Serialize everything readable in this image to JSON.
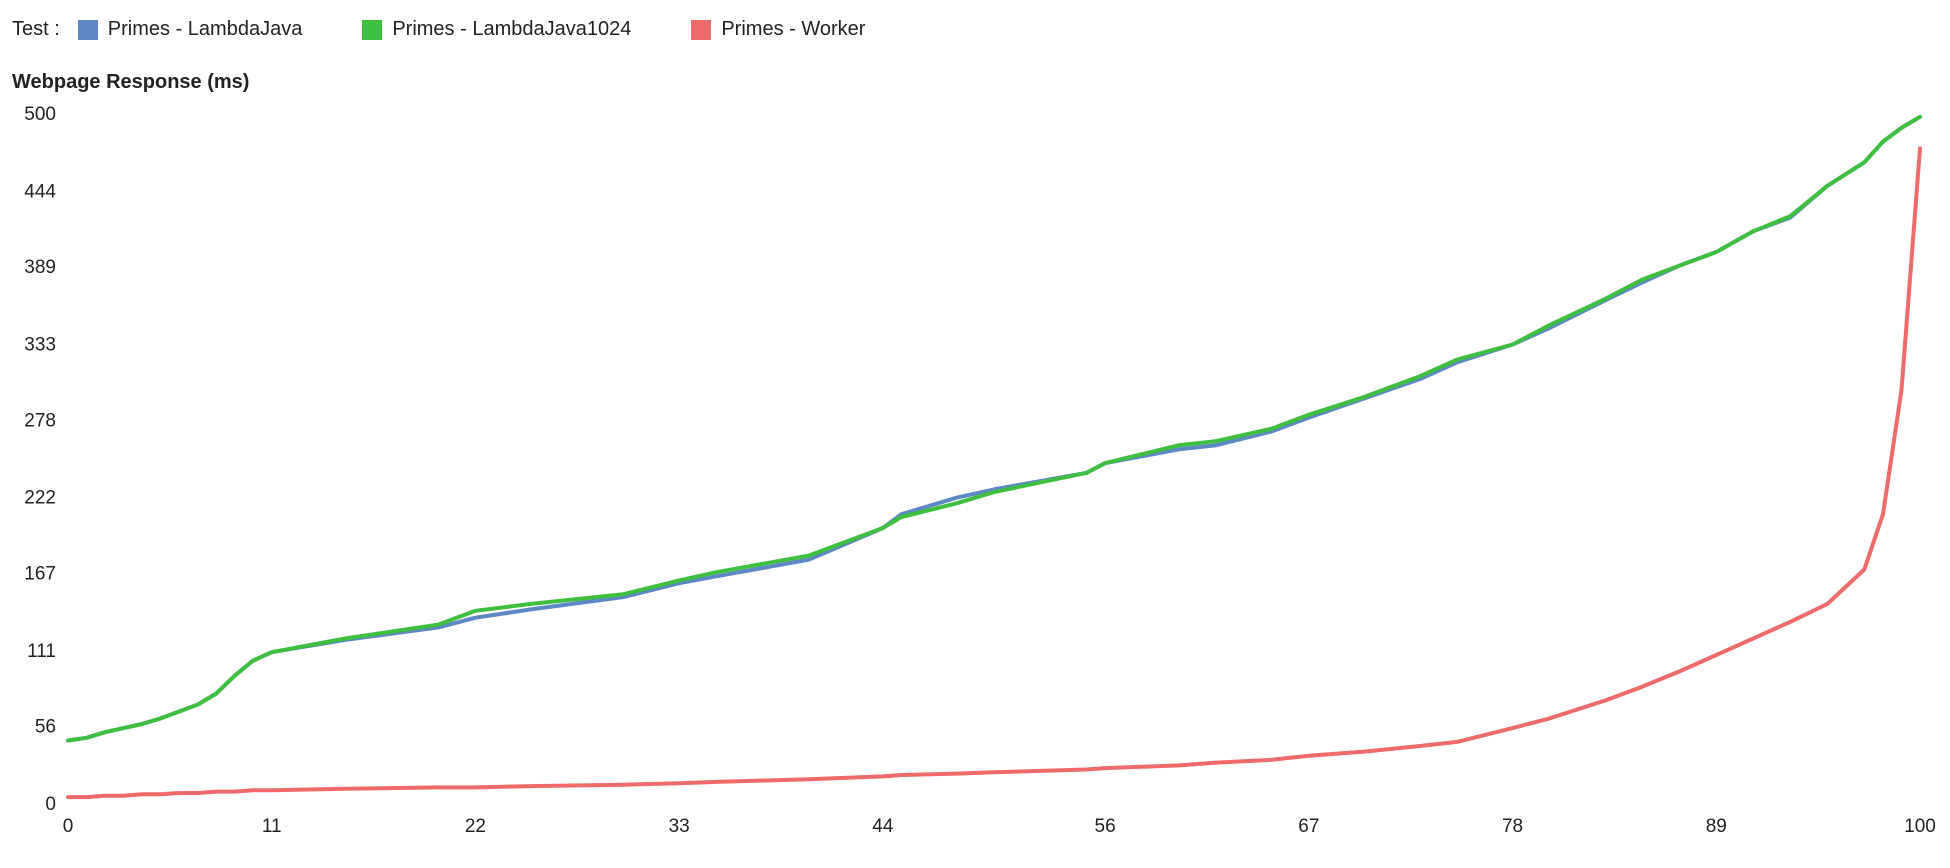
{
  "legend": {
    "label": "Test :",
    "items": [
      {
        "name": "Primes - LambdaJava",
        "stroke": "#5d88c4",
        "fill": "#5d88c4"
      },
      {
        "name": "Primes - LambdaJava1024",
        "stroke": "#3fbf3f",
        "fill": "#3fbf3f"
      },
      {
        "name": "Primes - Worker",
        "stroke": "#ef6a6a",
        "fill": "#ef6a6a"
      }
    ]
  },
  "ytitle": "Webpage Response (ms)",
  "chart_data": {
    "type": "line",
    "xlabel": "",
    "ylabel": "Webpage Response (ms)",
    "xlim": [
      0,
      100
    ],
    "ylim": [
      0,
      500
    ],
    "x_ticks": [
      0,
      11,
      22,
      33,
      44,
      56,
      67,
      78,
      89,
      100
    ],
    "y_ticks": [
      0,
      56,
      111,
      167,
      222,
      278,
      333,
      389,
      444,
      500
    ],
    "x": [
      0,
      1,
      2,
      3,
      4,
      5,
      6,
      7,
      8,
      9,
      10,
      11,
      15,
      20,
      22,
      25,
      30,
      33,
      35,
      40,
      44,
      45,
      48,
      50,
      55,
      56,
      60,
      62,
      65,
      67,
      70,
      73,
      75,
      78,
      80,
      83,
      85,
      87,
      89,
      91,
      93,
      95,
      97,
      98,
      99,
      100
    ],
    "series": [
      {
        "name": "Primes - LambdaJava",
        "color": "#5d88c4",
        "values": [
          46,
          48,
          52,
          55,
          58,
          62,
          67,
          72,
          80,
          93,
          104,
          110,
          119,
          128,
          135,
          141,
          150,
          160,
          165,
          177,
          200,
          210,
          222,
          228,
          240,
          247,
          257,
          260,
          270,
          280,
          294,
          308,
          320,
          333,
          345,
          365,
          378,
          390,
          400,
          415,
          425,
          448,
          465,
          480,
          490,
          498
        ]
      },
      {
        "name": "Primes - LambdaJava1024",
        "color": "#3fbf3f",
        "values": [
          46,
          48,
          52,
          55,
          58,
          62,
          67,
          72,
          80,
          93,
          104,
          110,
          120,
          130,
          140,
          145,
          152,
          162,
          168,
          180,
          200,
          208,
          218,
          226,
          240,
          247,
          260,
          263,
          272,
          282,
          295,
          310,
          322,
          333,
          347,
          366,
          380,
          390,
          400,
          415,
          426,
          448,
          465,
          480,
          490,
          498
        ]
      },
      {
        "name": "Primes - Worker",
        "color": "#ef6a6a",
        "values": [
          5,
          5,
          6,
          6,
          7,
          7,
          8,
          8,
          9,
          9,
          10,
          10,
          11,
          12,
          12,
          13,
          14,
          15,
          16,
          18,
          20,
          21,
          22,
          23,
          25,
          26,
          28,
          30,
          32,
          35,
          38,
          42,
          45,
          55,
          62,
          75,
          85,
          96,
          108,
          120,
          132,
          145,
          170,
          210,
          300,
          475
        ]
      }
    ]
  }
}
